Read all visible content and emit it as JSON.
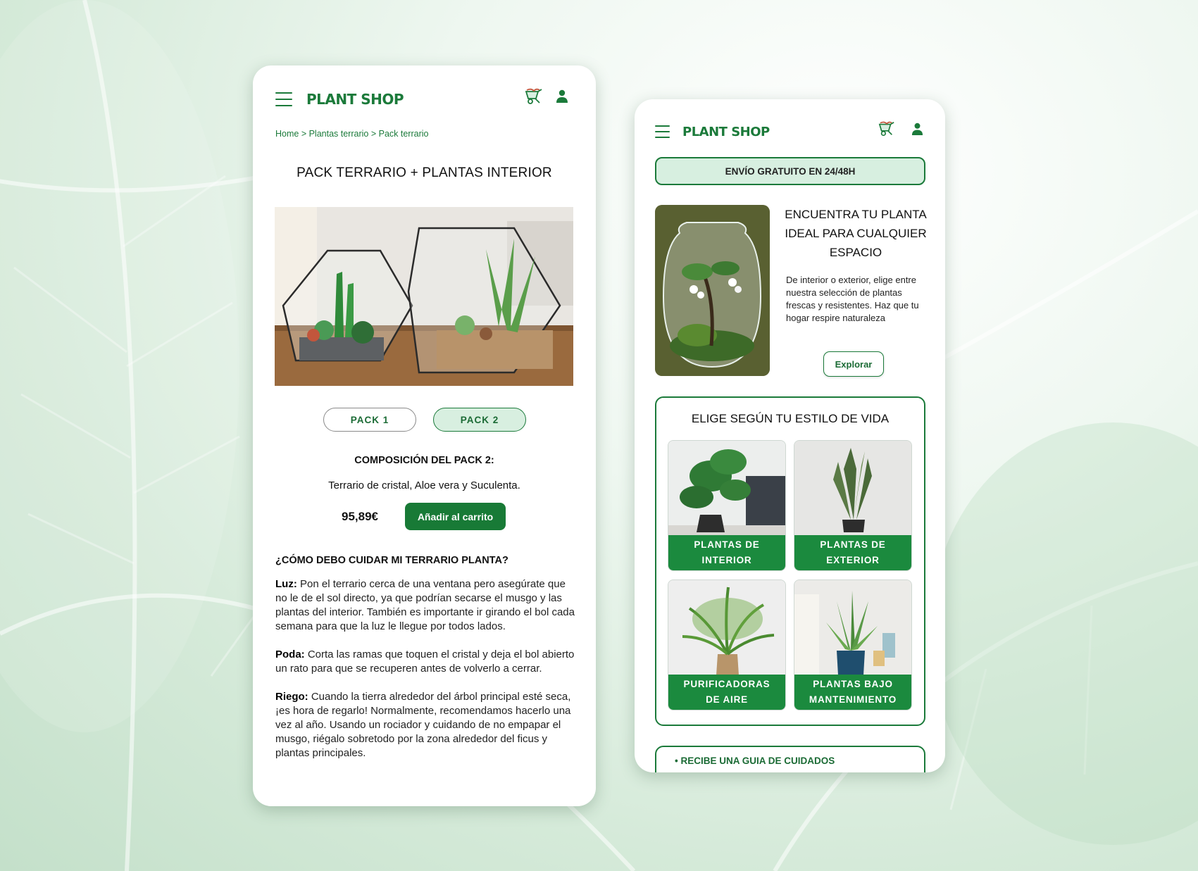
{
  "left_screen": {
    "header": {
      "logo": "PLANT SHOP",
      "menu_icon": "hamburger-icon",
      "cart_icon": "wheelbarrow-cart-icon",
      "user_icon": "user-icon"
    },
    "breadcrumb": {
      "home": "Home",
      "sep1": " > ",
      "category": "Plantas terrario",
      "sep2": " > ",
      "current": "Pack terrario"
    },
    "product": {
      "title": "PACK TERRARIO + PLANTAS INTERIOR",
      "packs": [
        "PACK 1",
        "PACK 2"
      ],
      "active_pack": "PACK 2",
      "composition_title": "COMPOSICIÓN DEL PACK 2:",
      "composition_text": "Terrario de cristal, Aloe vera y Suculenta.",
      "price": "95,89€",
      "add_to_cart": "Añadir al carrito"
    },
    "care": {
      "title": "¿CÓMO DEBO CUIDAR MI TERRARIO PLANTA?",
      "sections": [
        {
          "label": "Luz:",
          "text": " Pon el terrario cerca de una ventana pero asegúrate que no le de el sol directo, ya que podrían secarse el musgo y las plantas del interior. También es importante ir girando el bol cada semana para que la luz le llegue por todos lados."
        },
        {
          "label": "Poda:",
          "text": " Corta las ramas que toquen el cristal y deja el bol abierto un rato para que se recuperen antes de volverlo a cerrar."
        },
        {
          "label": "Riego:",
          "text": " Cuando la tierra alrededor del árbol principal esté seca, ¡es hora de regarlo! Normalmente, recomendamos hacerlo una vez al año. Usando un rociador y cuidando de no empapar el musgo, riégalo sobretodo por la zona alrededor del ficus y plantas principales."
        }
      ]
    }
  },
  "right_screen": {
    "header": {
      "logo": "PLANT SHOP",
      "menu_icon": "hamburger-icon",
      "cart_icon": "wheelbarrow-cart-icon",
      "user_icon": "user-icon"
    },
    "shipping_banner": "ENVÍO GRATUITO EN 24/48H",
    "hero": {
      "title": "ENCUENTRA TU PLANTA IDEAL PARA CUALQUIER ESPACIO",
      "text": "De interior o exterior, elige entre nuestra selección de plantas frescas y resistentes. Haz que tu hogar respire naturaleza",
      "button": "Explorar"
    },
    "lifestyle": {
      "title": "ELIGE SEGÚN TU ESTILO DE VIDA",
      "categories": [
        {
          "line1": "PLANTAS DE",
          "line2": "INTERIOR"
        },
        {
          "line1": "PLANTAS DE",
          "line2": "EXTERIOR"
        },
        {
          "line1": "PURIFICADORAS",
          "line2": "DE AIRE"
        },
        {
          "line1": "PLANTAS BAJO",
          "line2": "MANTENIMIENTO"
        }
      ]
    },
    "guide": "• RECIBE UNA GUIA DE CUIDADOS"
  },
  "colors": {
    "brand_green": "#1b7a3a",
    "button_green": "#187a36",
    "light_green": "#d7efe0"
  }
}
